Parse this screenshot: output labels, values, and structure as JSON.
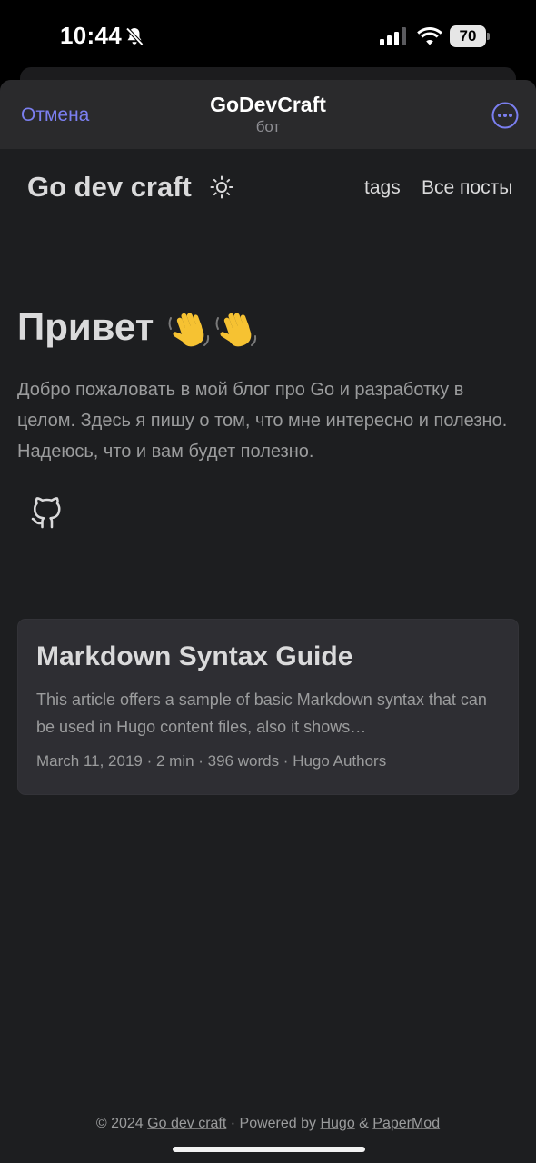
{
  "status_bar": {
    "time": "10:44",
    "battery": "70",
    "icons": [
      "bell-off-icon",
      "cellular-signal-icon",
      "wifi-icon",
      "battery-icon"
    ]
  },
  "telegram_header": {
    "cancel_label": "Отмена",
    "title": "GoDevCraft",
    "subtitle": "бот",
    "more_icon": "more-icon",
    "accent_color": "#7b7ff0"
  },
  "site": {
    "logo": "Go dev craft",
    "theme_icon": "sun-icon",
    "nav": {
      "tags_label": "tags",
      "all_posts_label": "Все посты"
    }
  },
  "hero": {
    "title": "Привет",
    "emoji": "👋👋",
    "text": "Добро пожаловать в мой блог про Go и разработку в целом. Здесь я пишу о том, что мне интересно и полезно. Надеюсь, что и вам будет полезно.",
    "social_icon": "github-icon"
  },
  "post": {
    "title": "Markdown Syntax Guide",
    "excerpt": "This article offers a sample of basic Markdown syntax that can be used in Hugo content files, also it shows…",
    "meta": "March 11, 2019 · 2 min · 396 words · Hugo Authors"
  },
  "footer": {
    "copyright": "© 2024 ",
    "site_link": "Go dev craft",
    "powered_by": " · Powered by ",
    "hugo_link": "Hugo",
    "amp": " & ",
    "papermod_link": "PaperMod"
  },
  "colors": {
    "background": "#1d1e20",
    "header_bg": "#2a2a2c",
    "card_bg": "#2e2e33",
    "primary_text": "#dadadb",
    "secondary_text": "#9b9c9d"
  }
}
